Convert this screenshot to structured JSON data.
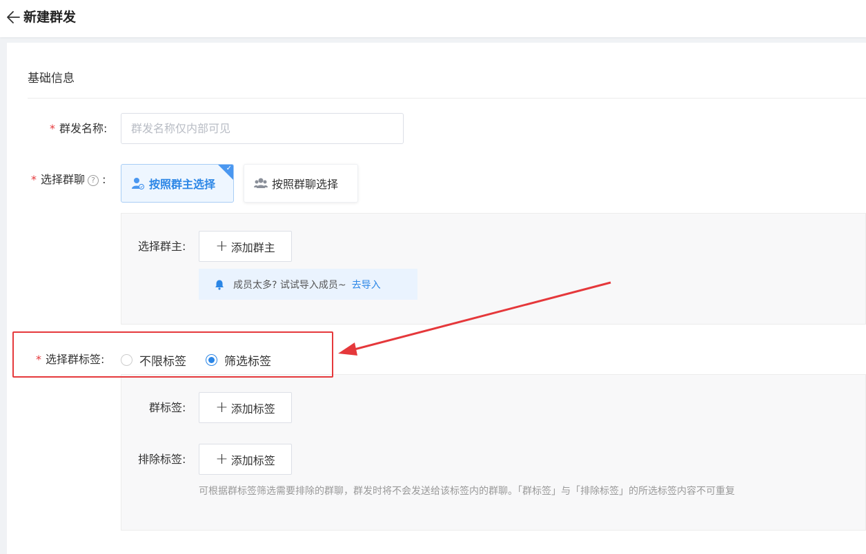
{
  "header": {
    "title": "新建群发"
  },
  "basic": {
    "section_title": "基础信息"
  },
  "form": {
    "name_label": "群发名称:",
    "name_placeholder": "群发名称仅内部可见",
    "group_label": "选择群聊",
    "group_label_suffix": ":",
    "help_icon": "?",
    "choice_owner": "按照群主选择",
    "choice_group": "按照群聊选择",
    "owner_label": "选择群主:",
    "add_owner": "添加群主",
    "tip_text": "成员太多? 试试导入成员~",
    "tip_link": "去导入",
    "tag_label": "选择群标签:",
    "radio_unlimited": "不限标签",
    "radio_filter": "筛选标签",
    "group_tag_label": "群标签:",
    "add_tag": "添加标签",
    "exclude_tag_label": "排除标签:",
    "add_exclude_tag": "添加标签",
    "hint": "可根据群标签筛选需要排除的群聊，群发时将不会发送给该标签内的群聊。「群标签」与「排除标签」的所选标签内容不可重复"
  },
  "icons": {
    "back": "arrow-left-icon",
    "owner": "user-icon",
    "group": "users-icon",
    "bell": "bell-icon",
    "check": "check-icon",
    "plus": "plus-icon"
  },
  "colors": {
    "accent": "#2b86e6",
    "required": "#e5383b",
    "annotation": "#e5383b"
  },
  "state": {
    "selected_choice": "按照群主选择",
    "selected_radio": "筛选标签"
  }
}
